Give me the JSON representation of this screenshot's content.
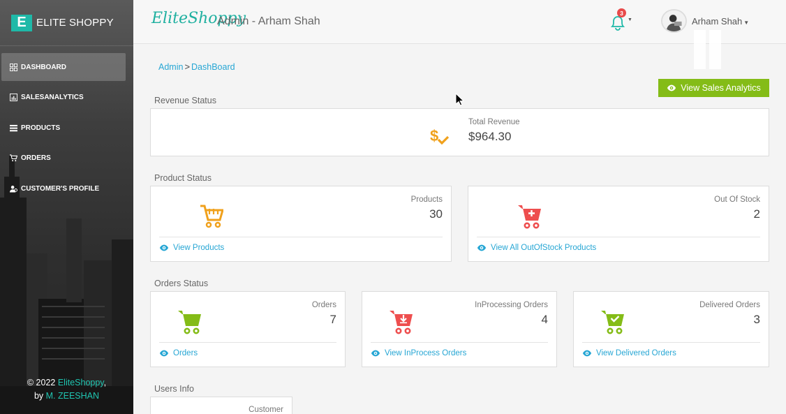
{
  "brand": {
    "logo_letter": "E",
    "name": "ELITE SHOPPY"
  },
  "nav": {
    "items": [
      {
        "label": "DASHBOARD",
        "icon": "dashboard-icon",
        "active": true
      },
      {
        "label": "SALESANALYTICS",
        "icon": "chart-icon",
        "active": false
      },
      {
        "label": "PRODUCTS",
        "icon": "list-icon",
        "active": false
      },
      {
        "label": "ORDERS",
        "icon": "cart-icon",
        "active": false
      },
      {
        "label": "CUSTOMER'S PROFILE",
        "icon": "users-icon",
        "active": false
      }
    ]
  },
  "footer": {
    "copyright": "© 2022 ",
    "brand": "EliteShoppy",
    "comma": ",",
    "by": "by ",
    "author": "M. ZEESHAN"
  },
  "header": {
    "logo_script": "EliteShoppy",
    "title": "Admin - Arham Shah",
    "notification_count": "3",
    "user_name": "Arham Shah"
  },
  "breadcrumb": {
    "root": "Admin",
    "sep": ">",
    "current": "DashBoard"
  },
  "actions": {
    "view_sales_analytics": "View Sales Analytics"
  },
  "sections": {
    "revenue": "Revenue Status",
    "product": "Product Status",
    "orders": "Orders Status",
    "users": "Users Info"
  },
  "revenue": {
    "label": "Total Revenue",
    "value": "$964.30"
  },
  "products": {
    "label": "Products",
    "value": "30",
    "link": "View Products"
  },
  "out_of_stock": {
    "label": "Out Of Stock",
    "value": "2",
    "link": "View All OutOfStock Products"
  },
  "orders": {
    "label": "Orders",
    "value": "7",
    "link": "Orders"
  },
  "inprocessing": {
    "label": "InProcessing Orders",
    "value": "4",
    "link": "View InProcess Orders"
  },
  "delivered": {
    "label": "Delivered Orders",
    "value": "3",
    "link": "View Delivered Orders"
  },
  "users": {
    "label": "Customer"
  },
  "colors": {
    "accent": "#1fb9a8",
    "link": "#26a6d4",
    "green": "#84bc17",
    "orange": "#f0a11c",
    "red": "#ee4e4e"
  }
}
